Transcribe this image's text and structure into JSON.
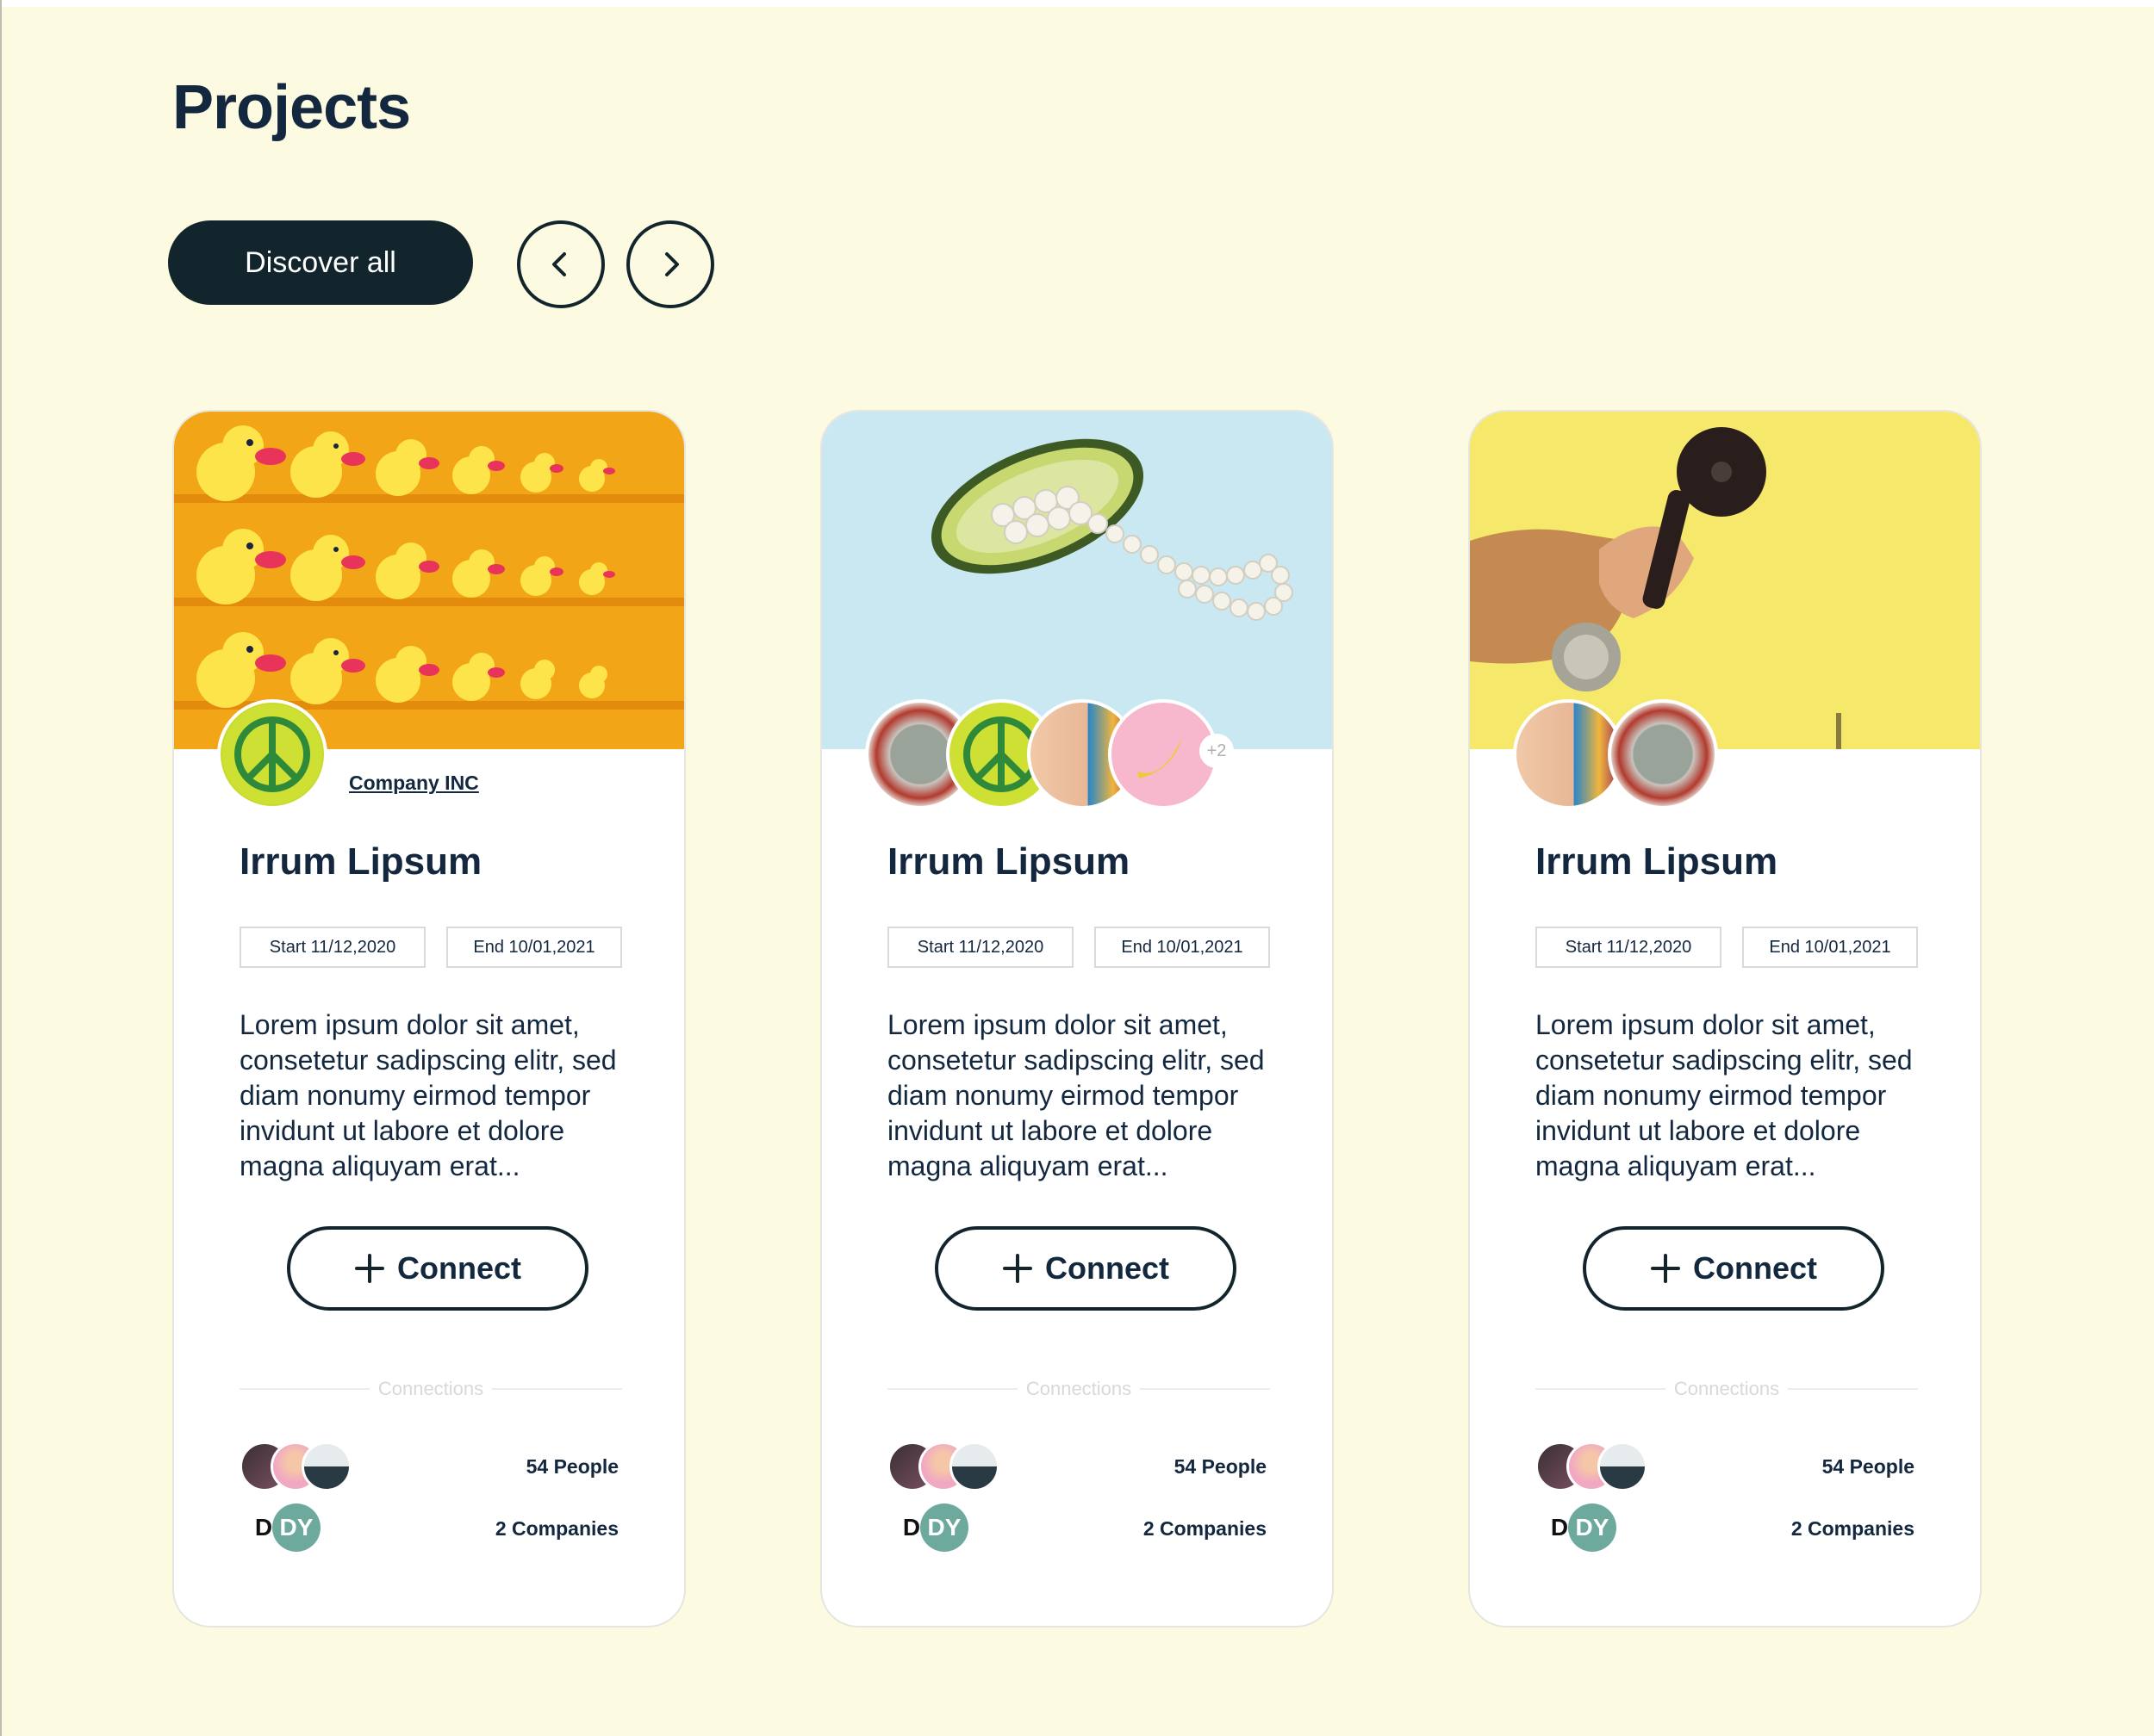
{
  "page": {
    "title": "Projects"
  },
  "toolbar": {
    "discover_label": "Discover all"
  },
  "colors": {
    "background": "#FCFAE0",
    "dark": "#13252C",
    "text": "#13273F"
  },
  "cards": [
    {
      "company": "Company INC",
      "title": "Irrum Lipsum",
      "start": "Start 11/12,2020",
      "end": "End 10/01,2021",
      "description": "Lorem ipsum dolor sit amet, consetetur sadipscing elitr, sed diam nonumy eirmod tempor invidunt ut labore et dolore magna aliquyam erat...",
      "connect_label": "Connect",
      "connections_label": "Connections",
      "people": "54 People",
      "companies": "2 Companies"
    },
    {
      "extra_count": "+2",
      "title": "Irrum Lipsum",
      "start": "Start 11/12,2020",
      "end": "End 10/01,2021",
      "description": "Lorem ipsum dolor sit amet, consetetur sadipscing elitr, sed diam nonumy eirmod tempor invidunt ut labore et dolore magna aliquyam erat...",
      "connect_label": "Connect",
      "connections_label": "Connections",
      "people": "54 People",
      "companies": "2 Companies"
    },
    {
      "title": "Irrum Lipsum",
      "start": "Start 11/12,2020",
      "end": "End 10/01,2021",
      "description": "Lorem ipsum dolor sit amet, consetetur sadipscing elitr, sed diam nonumy eirmod tempor invidunt ut labore et dolore magna aliquyam erat...",
      "connect_label": "Connect",
      "connections_label": "Connections",
      "people": "54 People",
      "companies": "2 Companies"
    }
  ],
  "logo_text": {
    "dy": "DY",
    "d": "D"
  }
}
